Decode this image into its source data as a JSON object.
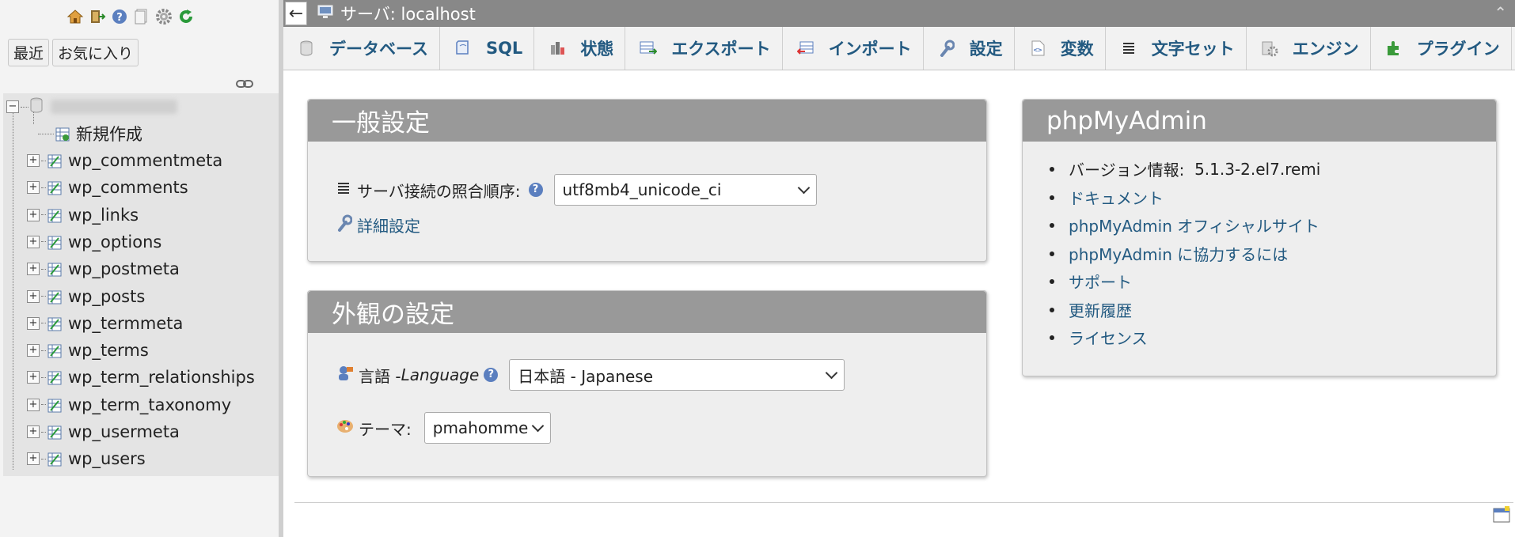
{
  "nav": {
    "tabs": [
      "最近",
      "お気に入り"
    ],
    "new_item": "新規作成",
    "tables": [
      "wp_commentmeta",
      "wp_comments",
      "wp_links",
      "wp_options",
      "wp_postmeta",
      "wp_posts",
      "wp_termmeta",
      "wp_terms",
      "wp_term_relationships",
      "wp_term_taxonomy",
      "wp_usermeta",
      "wp_users"
    ]
  },
  "topbar": {
    "back": "←",
    "server_label": "サーバ:  localhost"
  },
  "menu": [
    {
      "label": "データベース",
      "icon": "database-icon"
    },
    {
      "label": "SQL",
      "icon": "sql-icon"
    },
    {
      "label": "状態",
      "icon": "status-icon"
    },
    {
      "label": "エクスポート",
      "icon": "export-icon"
    },
    {
      "label": "インポート",
      "icon": "import-icon"
    },
    {
      "label": "設定",
      "icon": "wrench-icon"
    },
    {
      "label": "変数",
      "icon": "variables-icon"
    },
    {
      "label": "文字セット",
      "icon": "charset-icon"
    },
    {
      "label": "エンジン",
      "icon": "engine-icon"
    },
    {
      "label": "プラグイン",
      "icon": "plugin-icon"
    }
  ],
  "general": {
    "title": "一般設定",
    "collation_label": "サーバ接続の照合順序:",
    "collation_value": "utf8mb4_unicode_ci",
    "more_settings": "詳細設定"
  },
  "appearance": {
    "title": "外観の設定",
    "language_label_jp": "言語 - ",
    "language_label_en": "Language",
    "language_value": "日本語 - Japanese",
    "theme_label": "テーマ:",
    "theme_value": "pmahomme"
  },
  "pma": {
    "title": "phpMyAdmin",
    "version_label": "バージョン情報:  ",
    "version_value": "5.1.3-2.el7.remi",
    "links": [
      "ドキュメント",
      "phpMyAdmin オフィシャルサイト",
      "phpMyAdmin に協力するには",
      "サポート",
      "更新履歴",
      "ライセンス"
    ]
  },
  "colors": {
    "link": "#235a81",
    "panel_header": "#999999",
    "topbar": "#888888"
  }
}
